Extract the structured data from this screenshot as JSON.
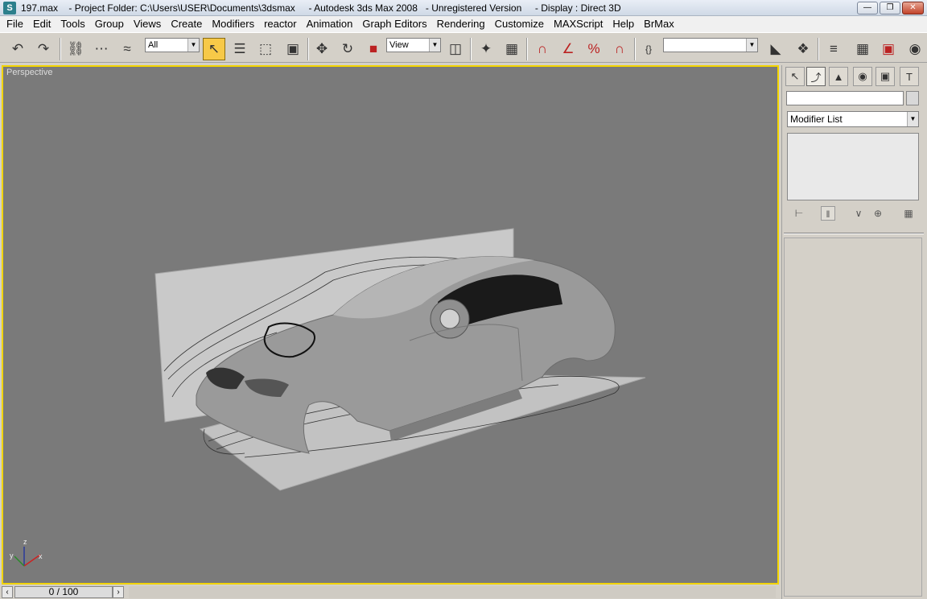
{
  "window": {
    "title": "197.max    - Project Folder: C:\\Users\\USER\\Documents\\3dsmax     - Autodesk 3ds Max 2008   - Unregistered Version     - Display : Direct 3D",
    "app_icon": "3ds-max-icon",
    "controls": [
      "minimize-icon",
      "maximize-icon",
      "close-icon"
    ]
  },
  "menubar": {
    "items": [
      "File",
      "Edit",
      "Tools",
      "Group",
      "Views",
      "Create",
      "Modifiers",
      "reactor",
      "Animation",
      "Graph Editors",
      "Rendering",
      "Customize",
      "MAXScript",
      "Help",
      "BrMax"
    ]
  },
  "toolbar": {
    "selection_filter": "All",
    "reference_coordinate_system": "View",
    "named_selection_set": "",
    "active_tool": "select-object"
  },
  "viewport": {
    "label": "Perspective",
    "border_color": "#f2d400",
    "background_color": "#7a7a7a",
    "axis_labels": [
      "z",
      "y",
      "x"
    ]
  },
  "command_panel": {
    "active_tab": "modify",
    "name_field": "",
    "modifier_list_label": "Modifier List"
  },
  "timeline": {
    "slider_label": "0 / 100"
  }
}
